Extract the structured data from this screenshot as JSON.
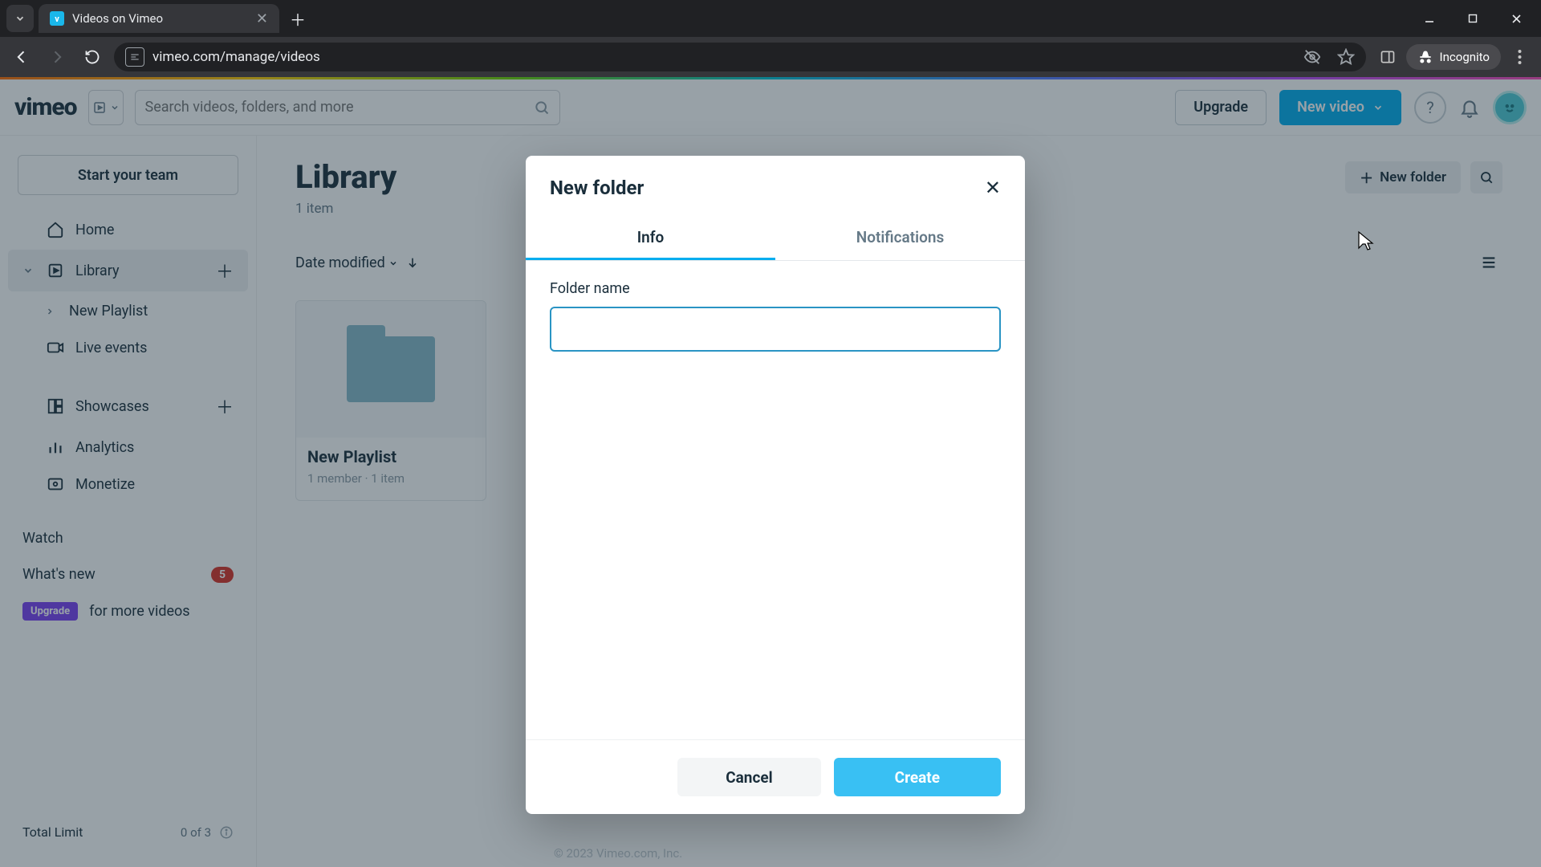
{
  "browser": {
    "tab_title": "Videos on Vimeo",
    "url": "vimeo.com/manage/videos",
    "incognito_label": "Incognito"
  },
  "header": {
    "logo": "vimeo",
    "search_placeholder": "Search videos, folders, and more",
    "upgrade": "Upgrade",
    "new_video": "New video"
  },
  "sidebar": {
    "start_team": "Start your team",
    "home": "Home",
    "library": "Library",
    "new_playlist": "New Playlist",
    "live_events": "Live events",
    "showcases": "Showcases",
    "analytics": "Analytics",
    "monetize": "Monetize",
    "watch": "Watch",
    "whats_new": "What's new",
    "whats_new_count": "5",
    "upgrade_chip": "Upgrade",
    "upgrade_text": "for more videos",
    "total_limit_label": "Total Limit",
    "total_limit_value": "0 of 3"
  },
  "main": {
    "title": "Library",
    "subtitle": "1 item",
    "new_folder": "New folder",
    "sort_label": "Date modified",
    "card": {
      "name": "New Playlist",
      "members": "1 member",
      "items": "1 item"
    },
    "footer": "© 2023 Vimeo.com, Inc."
  },
  "modal": {
    "title": "New folder",
    "tab_info": "Info",
    "tab_notifications": "Notifications",
    "field_label": "Folder name",
    "input_value": "",
    "cancel": "Cancel",
    "create": "Create"
  }
}
